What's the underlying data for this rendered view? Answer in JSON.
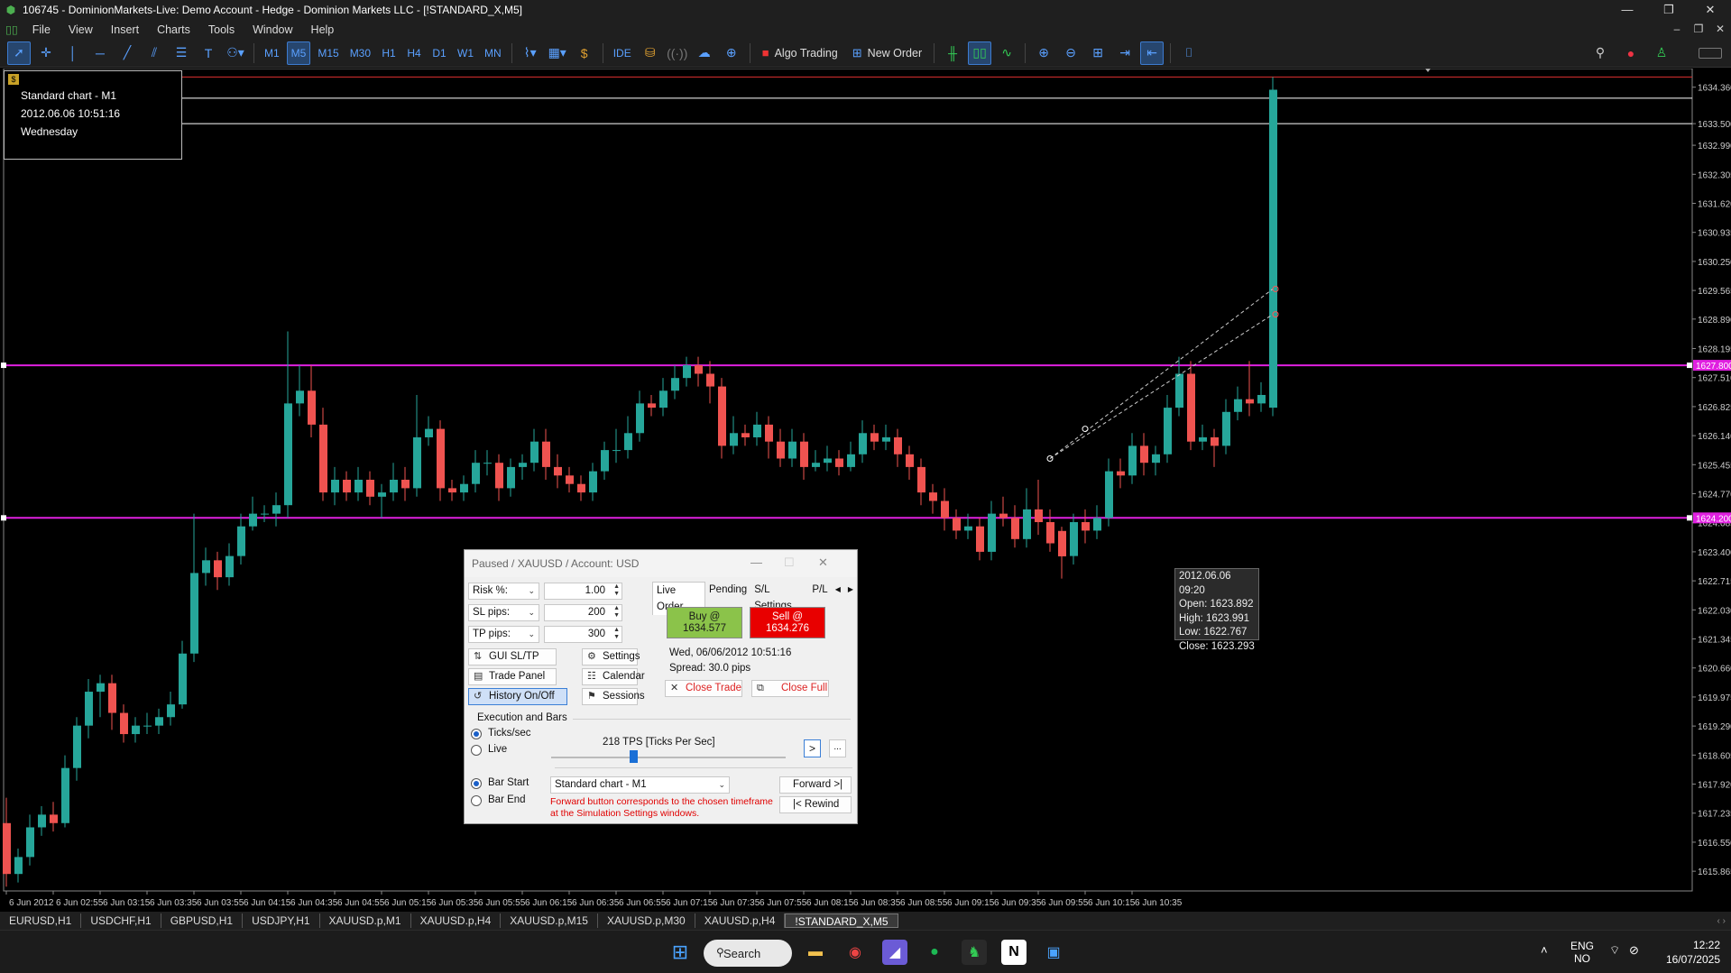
{
  "window": {
    "title": "106745 - DominionMarkets-Live: Demo Account - Hedge - Dominion Markets LLC - [!STANDARD_X,M5]",
    "controls": [
      "—",
      "❐",
      "✕"
    ]
  },
  "menu": [
    "File",
    "View",
    "Insert",
    "Charts",
    "Tools",
    "Window",
    "Help"
  ],
  "toolbar": {
    "timeframes": [
      "M1",
      "M5",
      "M15",
      "M30",
      "H1",
      "H4",
      "D1",
      "W1",
      "MN"
    ],
    "active_timeframe": "M5",
    "ide": "IDE",
    "algo_trading": "Algo Trading",
    "new_order": "New Order"
  },
  "chart_info": {
    "name": "Standard chart - M1",
    "datetime": "2012.06.06 10:51:16",
    "weekday": "Wednesday"
  },
  "tooltip": {
    "date": "2012.06.06 09:20",
    "open": "Open: 1623.892",
    "high": "High: 1623.991",
    "low": "Low: 1622.767",
    "close": "Close: 1623.293"
  },
  "chart_data": {
    "type": "candlestick",
    "symbol": "XAUUSD",
    "timeframe": "M5",
    "ylim": [
      1615.4,
      1634.8
    ],
    "y_ticks": [
      "1634.360",
      "1633.500",
      "1632.990",
      "1632.305",
      "1631.620",
      "1630.935",
      "1630.250",
      "1629.565",
      "1628.890",
      "1628.195",
      "1627.510",
      "1626.825",
      "1626.140",
      "1625.455",
      "1624.770",
      "1624.085",
      "1623.400",
      "1622.715",
      "1622.030",
      "1621.345",
      "1620.660",
      "1619.975",
      "1619.290",
      "1618.605",
      "1617.920",
      "1617.235",
      "1616.550",
      "1615.865"
    ],
    "y_tick_values": [
      1634.36,
      1633.5,
      1632.99,
      1632.305,
      1631.62,
      1630.935,
      1630.25,
      1629.565,
      1628.89,
      1628.195,
      1627.51,
      1626.825,
      1626.14,
      1625.455,
      1624.77,
      1624.085,
      1623.4,
      1622.715,
      1622.03,
      1621.345,
      1620.66,
      1619.975,
      1619.29,
      1618.605,
      1617.92,
      1617.235,
      1616.55,
      1615.865
    ],
    "x_ticks": [
      "6 Jun 2012",
      "6 Jun 02:55",
      "6 Jun 03:15",
      "6 Jun 03:35",
      "6 Jun 03:55",
      "6 Jun 04:15",
      "6 Jun 04:35",
      "6 Jun 04:55",
      "6 Jun 05:15",
      "6 Jun 05:35",
      "6 Jun 05:55",
      "6 Jun 06:15",
      "6 Jun 06:35",
      "6 Jun 06:55",
      "6 Jun 07:15",
      "6 Jun 07:35",
      "6 Jun 07:55",
      "6 Jun 08:15",
      "6 Jun 08:35",
      "6 Jun 08:55",
      "6 Jun 09:15",
      "6 Jun 09:35",
      "6 Jun 09:55",
      "6 Jun 10:15",
      "6 Jun 10:35"
    ],
    "price_labels": [
      {
        "text": "1627.800",
        "value": 1627.8,
        "color": "#e020e0"
      },
      {
        "text": "1624.200",
        "value": 1624.2,
        "color": "#e020e0"
      }
    ],
    "hlines": [
      {
        "value": 1634.6,
        "color": "#e03030"
      },
      {
        "value": 1634.1,
        "color": "#ffffff"
      },
      {
        "value": 1633.5,
        "color": "#ffffff"
      },
      {
        "value": 1627.8,
        "color": "#e020e0"
      },
      {
        "value": 1624.2,
        "color": "#e020e0"
      }
    ],
    "colors": {
      "up": "#26a69a",
      "down": "#ef5350"
    },
    "candles": [
      [
        1617.0,
        1615.8,
        1617.6,
        1615.5
      ],
      [
        1615.8,
        1616.2,
        1616.4,
        1615.6
      ],
      [
        1616.2,
        1616.9,
        1617.2,
        1616.0
      ],
      [
        1616.9,
        1617.2,
        1617.4,
        1616.7
      ],
      [
        1617.2,
        1617.0,
        1617.5,
        1616.8
      ],
      [
        1617.0,
        1618.3,
        1618.6,
        1616.9
      ],
      [
        1618.3,
        1619.3,
        1619.5,
        1618.0
      ],
      [
        1619.3,
        1620.1,
        1620.4,
        1619.0
      ],
      [
        1620.1,
        1620.3,
        1620.5,
        1619.5
      ],
      [
        1620.3,
        1619.6,
        1620.5,
        1619.2
      ],
      [
        1619.6,
        1619.1,
        1619.8,
        1618.9
      ],
      [
        1619.1,
        1619.3,
        1619.5,
        1618.9
      ],
      [
        1619.3,
        1619.3,
        1619.6,
        1619.1
      ],
      [
        1619.3,
        1619.5,
        1619.7,
        1619.1
      ],
      [
        1619.5,
        1619.8,
        1620.1,
        1619.3
      ],
      [
        1619.8,
        1621.0,
        1621.3,
        1619.7
      ],
      [
        1621.0,
        1622.9,
        1624.3,
        1620.8
      ],
      [
        1622.9,
        1623.2,
        1623.5,
        1622.6
      ],
      [
        1623.2,
        1622.8,
        1623.4,
        1622.5
      ],
      [
        1622.8,
        1623.3,
        1623.6,
        1622.6
      ],
      [
        1623.3,
        1624.0,
        1624.3,
        1623.1
      ],
      [
        1624.0,
        1624.3,
        1624.7,
        1623.9
      ],
      [
        1624.3,
        1624.3,
        1624.5,
        1624.1
      ],
      [
        1624.3,
        1624.5,
        1624.8,
        1624.0
      ],
      [
        1624.5,
        1626.9,
        1628.6,
        1624.2
      ],
      [
        1626.9,
        1627.2,
        1627.8,
        1626.6
      ],
      [
        1627.2,
        1626.4,
        1627.8,
        1626.1
      ],
      [
        1626.4,
        1624.8,
        1626.8,
        1624.6
      ],
      [
        1624.8,
        1625.1,
        1625.4,
        1624.5
      ],
      [
        1625.1,
        1624.8,
        1625.3,
        1624.6
      ],
      [
        1624.8,
        1625.1,
        1625.4,
        1624.6
      ],
      [
        1625.1,
        1624.7,
        1625.3,
        1624.5
      ],
      [
        1624.7,
        1624.8,
        1625.0,
        1624.2
      ],
      [
        1624.8,
        1625.1,
        1625.5,
        1624.6
      ],
      [
        1625.1,
        1624.9,
        1625.4,
        1624.6
      ],
      [
        1624.9,
        1626.1,
        1627.1,
        1624.7
      ],
      [
        1626.1,
        1626.3,
        1626.6,
        1625.9
      ],
      [
        1626.3,
        1624.9,
        1626.5,
        1624.6
      ],
      [
        1624.9,
        1624.8,
        1625.1,
        1624.6
      ],
      [
        1624.8,
        1625.0,
        1625.2,
        1624.6
      ],
      [
        1625.0,
        1625.5,
        1625.8,
        1624.8
      ],
      [
        1625.5,
        1625.5,
        1625.8,
        1625.2
      ],
      [
        1625.5,
        1624.9,
        1625.7,
        1624.6
      ],
      [
        1624.9,
        1625.4,
        1625.6,
        1624.7
      ],
      [
        1625.4,
        1625.5,
        1625.7,
        1625.1
      ],
      [
        1625.5,
        1626.0,
        1626.3,
        1625.3
      ],
      [
        1626.0,
        1625.4,
        1626.3,
        1625.1
      ],
      [
        1625.4,
        1625.2,
        1625.7,
        1624.9
      ],
      [
        1625.2,
        1625.0,
        1625.4,
        1624.8
      ],
      [
        1625.0,
        1624.8,
        1625.2,
        1624.6
      ],
      [
        1624.8,
        1625.3,
        1625.5,
        1624.6
      ],
      [
        1625.3,
        1625.8,
        1626.0,
        1625.1
      ],
      [
        1625.8,
        1625.8,
        1626.3,
        1625.5
      ],
      [
        1625.8,
        1626.2,
        1626.6,
        1625.6
      ],
      [
        1626.2,
        1626.9,
        1627.2,
        1626.0
      ],
      [
        1626.9,
        1626.8,
        1627.1,
        1626.6
      ],
      [
        1626.8,
        1627.2,
        1627.5,
        1626.6
      ],
      [
        1627.2,
        1627.5,
        1627.8,
        1627.0
      ],
      [
        1627.5,
        1627.8,
        1628.0,
        1627.3
      ],
      [
        1627.8,
        1627.6,
        1628.0,
        1627.3
      ],
      [
        1627.6,
        1627.3,
        1627.9,
        1626.9
      ],
      [
        1627.3,
        1625.9,
        1627.5,
        1625.6
      ],
      [
        1625.9,
        1626.2,
        1626.6,
        1625.7
      ],
      [
        1626.2,
        1626.1,
        1626.4,
        1625.9
      ],
      [
        1626.1,
        1626.4,
        1626.7,
        1625.9
      ],
      [
        1626.4,
        1626.0,
        1626.6,
        1625.6
      ],
      [
        1626.0,
        1625.6,
        1626.3,
        1625.4
      ],
      [
        1625.6,
        1626.0,
        1626.3,
        1625.4
      ],
      [
        1626.0,
        1625.4,
        1626.2,
        1625.1
      ],
      [
        1625.4,
        1625.5,
        1625.8,
        1625.3
      ],
      [
        1625.5,
        1625.6,
        1625.9,
        1625.3
      ],
      [
        1625.6,
        1625.4,
        1625.8,
        1625.2
      ],
      [
        1625.4,
        1625.7,
        1626.0,
        1625.3
      ],
      [
        1625.7,
        1626.2,
        1626.5,
        1625.5
      ],
      [
        1626.2,
        1626.0,
        1626.4,
        1625.8
      ],
      [
        1626.0,
        1626.1,
        1626.4,
        1625.8
      ],
      [
        1626.1,
        1625.7,
        1626.3,
        1625.4
      ],
      [
        1625.7,
        1625.4,
        1625.9,
        1625.1
      ],
      [
        1625.4,
        1624.8,
        1625.6,
        1624.5
      ],
      [
        1624.8,
        1624.6,
        1625.0,
        1624.3
      ],
      [
        1624.6,
        1624.2,
        1624.9,
        1623.9
      ],
      [
        1624.2,
        1623.9,
        1624.4,
        1623.7
      ],
      [
        1623.9,
        1624.0,
        1624.3,
        1623.7
      ],
      [
        1624.0,
        1623.4,
        1624.2,
        1623.2
      ],
      [
        1623.4,
        1624.3,
        1624.6,
        1623.2
      ],
      [
        1624.3,
        1624.2,
        1624.7,
        1624.0
      ],
      [
        1624.2,
        1623.7,
        1624.5,
        1623.5
      ],
      [
        1623.7,
        1624.4,
        1624.9,
        1623.5
      ],
      [
        1624.4,
        1624.1,
        1625.1,
        1623.8
      ],
      [
        1624.1,
        1623.6,
        1624.4,
        1623.4
      ],
      [
        1623.892,
        1623.293,
        1623.991,
        1622.767
      ],
      [
        1623.3,
        1624.1,
        1624.3,
        1623.1
      ],
      [
        1624.1,
        1623.9,
        1624.4,
        1623.6
      ],
      [
        1623.9,
        1624.2,
        1624.5,
        1623.7
      ],
      [
        1624.2,
        1625.3,
        1625.6,
        1624.0
      ],
      [
        1625.3,
        1625.2,
        1625.6,
        1624.9
      ],
      [
        1625.2,
        1625.9,
        1626.2,
        1625.0
      ],
      [
        1625.9,
        1625.5,
        1626.2,
        1625.2
      ],
      [
        1625.5,
        1625.7,
        1625.9,
        1625.2
      ],
      [
        1625.7,
        1626.8,
        1627.1,
        1625.5
      ],
      [
        1626.8,
        1627.6,
        1628.0,
        1626.6
      ],
      [
        1627.6,
        1626.0,
        1627.9,
        1625.8
      ],
      [
        1626.0,
        1626.1,
        1626.4,
        1625.8
      ],
      [
        1626.1,
        1625.9,
        1626.3,
        1625.4
      ],
      [
        1625.9,
        1626.7,
        1627.0,
        1625.7
      ],
      [
        1626.7,
        1627.0,
        1627.3,
        1626.5
      ],
      [
        1627.0,
        1626.9,
        1627.9,
        1626.6
      ],
      [
        1626.9,
        1627.1,
        1627.4,
        1626.7
      ],
      [
        1626.8,
        1634.3,
        1634.6,
        1626.6
      ]
    ],
    "x_tick_every": 4
  },
  "sheet_tabs": [
    "EURUSD,H1",
    "USDCHF,H1",
    "GBPUSD,H1",
    "USDJPY,H1",
    "XAUUSD.p,M1",
    "XAUUSD.p,H4",
    "XAUUSD.p,M15",
    "XAUUSD.p,M30",
    "XAUUSD.p,H4",
    "!STANDARD_X,M5"
  ],
  "active_tab_index": 9,
  "dialog": {
    "title": "Paused / XAUUSD / Account: USD",
    "risk_label": "Risk %:",
    "risk_value": "1.00",
    "sl_label": "SL pips:",
    "sl_value": "200",
    "tp_label": "TP pips:",
    "tp_value": "300",
    "gui_sltp": "GUI SL/TP",
    "settings": "Settings",
    "trade_panel": "Trade Panel",
    "calendar": "Calendar",
    "history": "History On/Off",
    "sessions": "Sessions",
    "tabs": [
      "Live Order",
      "Pending",
      "S/L Settings",
      "P/L"
    ],
    "buy_label": "Buy @",
    "buy_price": "1634.577",
    "sell_label": "Sell @",
    "sell_price": "1634.276",
    "datetime": "Wed, 06/06/2012  10:51:16",
    "spread": "Spread: 30.0 pips",
    "close_trade": "Close Trade",
    "close_full": "Close Full",
    "exec_section": "Execution and Bars",
    "ticks_label": "Ticks/sec",
    "live_label": "Live",
    "speed_text": "218 TPS [Ticks Per Sec]",
    "speed_level": 0.35,
    "play": ">",
    "more": "...",
    "bar_start": "Bar Start",
    "bar_end": "Bar End",
    "chart_select": "Standard chart - M1",
    "forward": "Forward >|",
    "rewind": "|< Rewind",
    "note": "Forward button corresponds to the chosen timeframe at the Simulation Settings windows."
  },
  "taskbar": {
    "search": "Search",
    "lang_top": "ENG",
    "lang_bottom": "NO",
    "time": "12:22",
    "date": "16/07/2025"
  }
}
